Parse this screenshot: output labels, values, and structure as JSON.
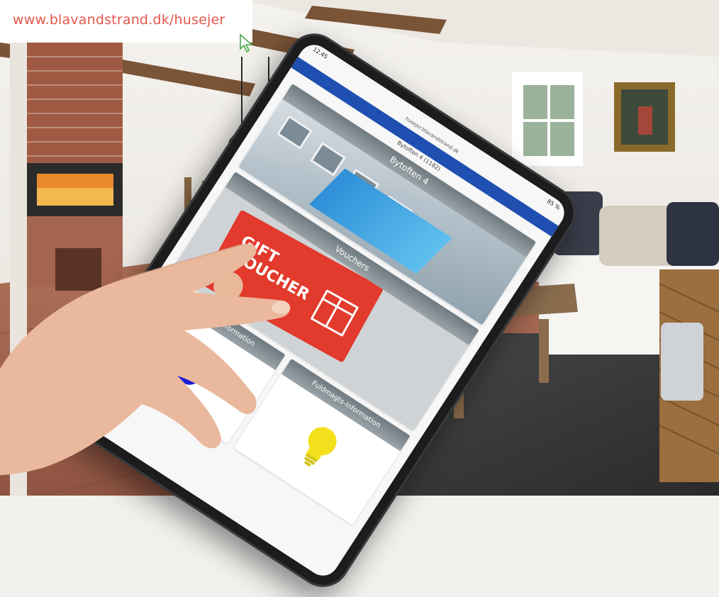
{
  "banner": {
    "url": "www.blavandstrand.dk/husejer"
  },
  "tablet": {
    "status_time": "12.45",
    "status_battery": "85 %",
    "address": "husejer.blavandstrand.dk",
    "house_title": "Bytoften 4 (1182)",
    "tiles": [
      {
        "label": "Bytoften 4",
        "kind": "house"
      },
      {
        "label": "Vouchers",
        "kind": "voucher",
        "voucher_text": "GIFT\nVOUCHER"
      },
      {
        "label": "Samtykke-information",
        "kind": "drop",
        "icon": "drop-icon",
        "icon_color": "#1a1ad6"
      },
      {
        "label": "Fuldmagts-information",
        "kind": "bulb",
        "icon": "bulb-icon",
        "icon_color": "#f2e01c"
      }
    ]
  },
  "colors": {
    "banner_text": "#e4574b",
    "tablet_header": "#1f4fb0",
    "tile_label_bg": "#7d878c"
  }
}
